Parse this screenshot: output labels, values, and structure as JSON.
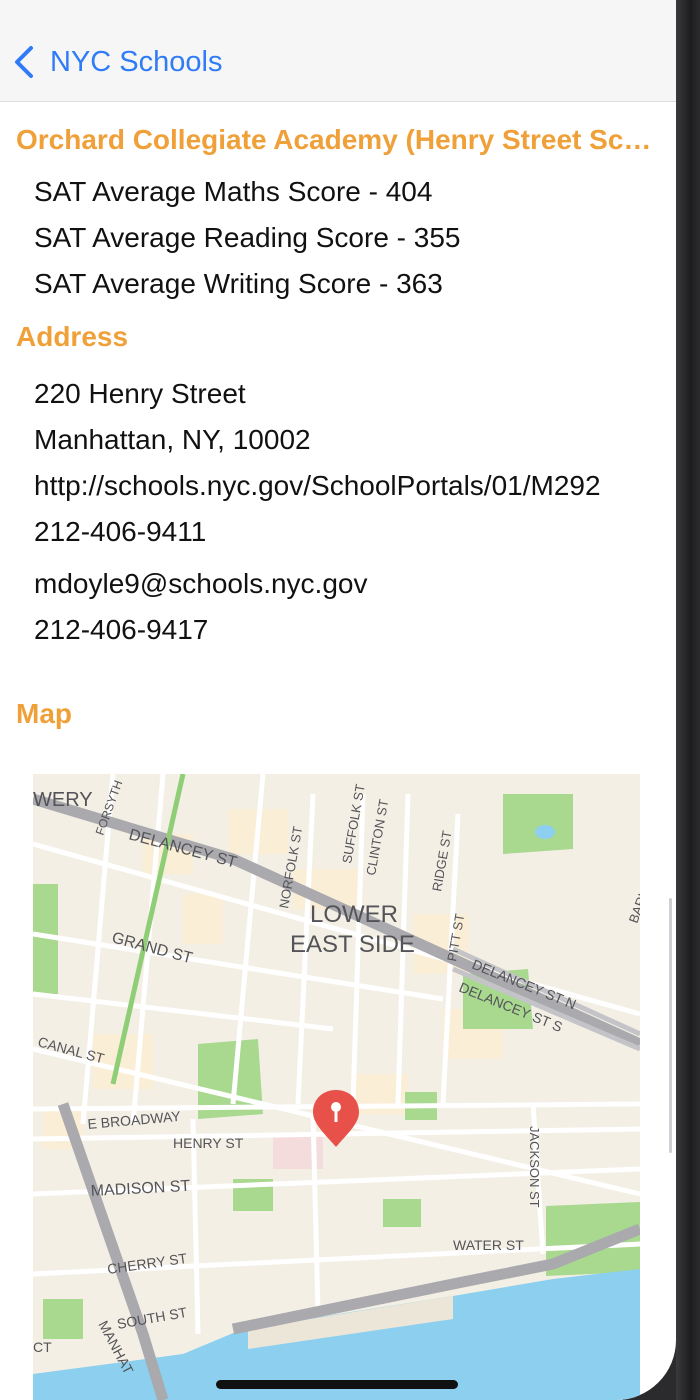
{
  "nav": {
    "back_label": "NYC Schools"
  },
  "school": {
    "name": "Orchard Collegiate Academy (Henry Street School)",
    "scores": [
      "SAT Average Maths Score - 404",
      "SAT Average Reading Score - 355",
      "SAT Average Writing Score - 363"
    ]
  },
  "address_section": {
    "title": "Address",
    "street": "220 Henry Street",
    "city": "Manhattan, NY, 10002",
    "website": "http://schools.nyc.gov/SchoolPortals/01/M292",
    "phone": "212-406-9411",
    "email": "mdoyle9@schools.nyc.gov",
    "fax": "212-406-9417"
  },
  "map_section": {
    "title": "Map",
    "labels": {
      "bowery": "WERY",
      "forsyth": "FORSYTH",
      "delancey": "DELANCEY ST",
      "norfolk": "NORFOLK ST",
      "suffolk": "SUFFOLK ST",
      "clinton": "CLINTON ST",
      "ridge": "RIDGE ST",
      "pitt": "PITT ST",
      "les1": "LOWER",
      "les2": "EAST SIDE",
      "grand": "GRAND ST",
      "delancey_n": "DELANCEY ST N",
      "delancey_s": "DELANCEY ST S",
      "baruch": "BARUCH",
      "canal": "CANAL ST",
      "ebroadway": "E BROADWAY",
      "henry": "HENRY ST",
      "madison": "MADISON ST",
      "jackson": "JACKSON ST",
      "water": "WATER ST",
      "cherry": "CHERRY ST",
      "south": "SOUTH ST",
      "manhattan": "MANHAT",
      "ct": "CT"
    },
    "colors": {
      "pin": "#e8514a",
      "park": "#a9d88f",
      "water": "#8ccfee",
      "highway": "#a9a9ae"
    }
  }
}
